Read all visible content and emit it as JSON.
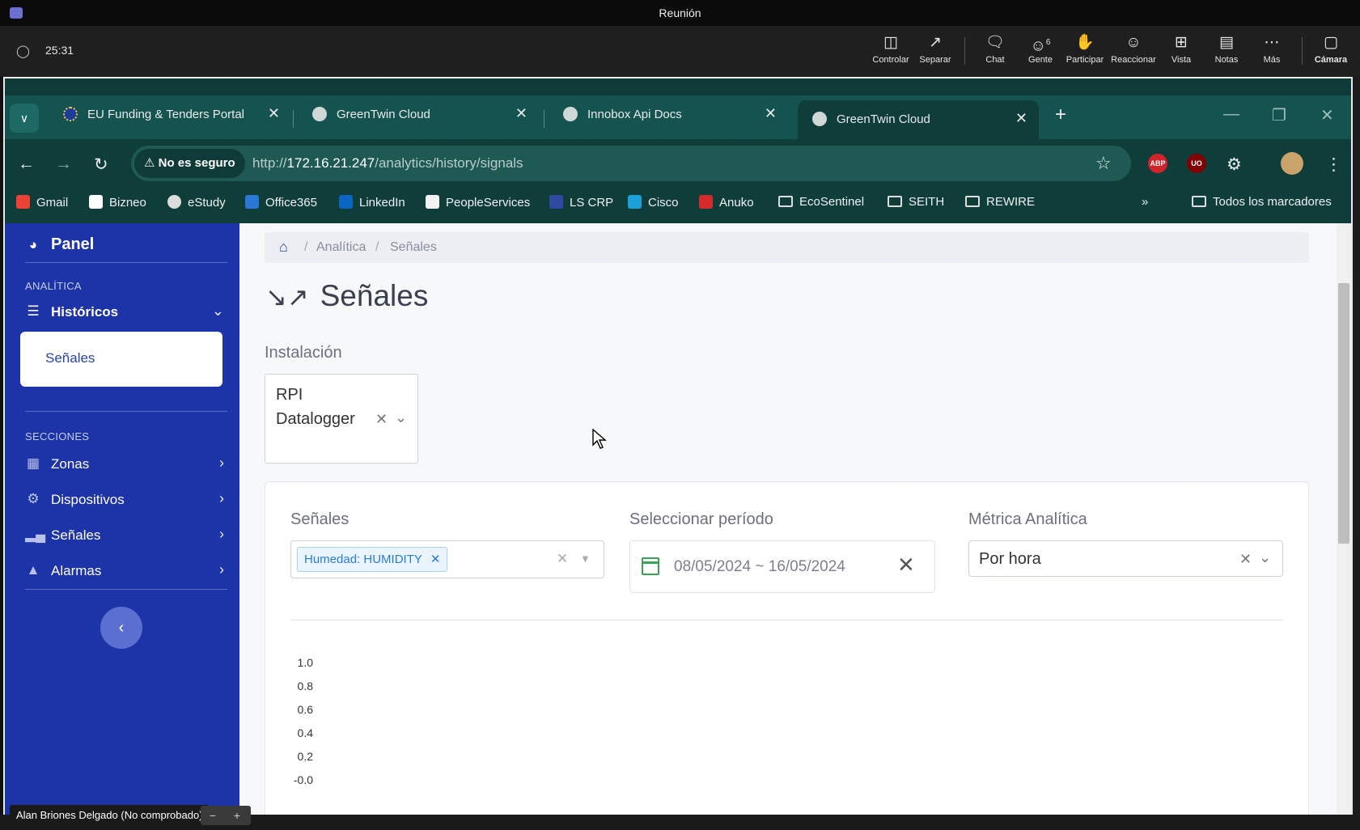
{
  "teams": {
    "title": "Reunión",
    "timer": "25:31",
    "toolbar": [
      {
        "label": "Controlar",
        "icon": "control-icon"
      },
      {
        "label": "Separar",
        "icon": "popout-icon"
      },
      {
        "label": "Chat",
        "icon": "chat-icon"
      },
      {
        "label": "Gente",
        "icon": "people-icon",
        "count": "6"
      },
      {
        "label": "Participar",
        "icon": "raise-hand-icon"
      },
      {
        "label": "Reaccionar",
        "icon": "react-icon"
      },
      {
        "label": "Vista",
        "icon": "view-icon"
      },
      {
        "label": "Notas",
        "icon": "notes-icon"
      },
      {
        "label": "Más",
        "icon": "more-icon"
      },
      {
        "label": "Cámara",
        "icon": "camera-icon"
      }
    ],
    "caption_name": "Alan Briones Delgado (No comprobado)"
  },
  "browser": {
    "tabs": [
      {
        "label": "EU Funding & Tenders Portal"
      },
      {
        "label": "GreenTwin Cloud"
      },
      {
        "label": "Innobox Api Docs"
      },
      {
        "label": "GreenTwin Cloud",
        "active": true
      }
    ],
    "security_chip": "No es seguro",
    "url_prefix": "http://",
    "url_host": "172.16.21.247",
    "url_path": "/analytics/history/signals",
    "extensions": [
      "ABP",
      "UO"
    ],
    "bookmarks": [
      {
        "label": "Gmail",
        "color": "#ea4335"
      },
      {
        "label": "Bizneo",
        "color": "#ffffff"
      },
      {
        "label": "eStudy",
        "color": "#dddddd"
      },
      {
        "label": "Office365",
        "color": "#2a78d6"
      },
      {
        "label": "LinkedIn",
        "color": "#0a66c2"
      },
      {
        "label": "PeopleServices",
        "color": "#f2f2f2"
      },
      {
        "label": "LS CRP",
        "color": "#2f4aa0"
      },
      {
        "label": "Cisco",
        "color": "#1ba0d7"
      },
      {
        "label": "Anuko",
        "color": "#d62b2b"
      },
      {
        "label": "EcoSentinel",
        "folder": true
      },
      {
        "label": "SEITH",
        "folder": true
      },
      {
        "label": "REWIRE",
        "folder": true
      }
    ],
    "all_bookmarks": "Todos los marcadores"
  },
  "sidebar": {
    "brand": "Panel",
    "section_analytics": "ANALÍTICA",
    "historicos": "Históricos",
    "active_item": "Señales",
    "section_sections": "SECCIONES",
    "items": [
      {
        "label": "Zonas",
        "icon": "building-icon"
      },
      {
        "label": "Dispositivos",
        "icon": "devices-icon"
      },
      {
        "label": "Señales",
        "icon": "signal-bars-icon"
      },
      {
        "label": "Alarmas",
        "icon": "warning-icon"
      }
    ]
  },
  "breadcrumb": [
    "Analítica",
    "Señales"
  ],
  "page_title": "Señales",
  "installation": {
    "label": "Instalación",
    "value": "RPI Datalogger"
  },
  "filters": {
    "signals_label": "Señales",
    "signal_chip": "Humedad: HUMIDITY",
    "period_label": "Seleccionar período",
    "period_value": "08/05/2024 ~ 16/05/2024",
    "metric_label": "Métrica Analítica",
    "metric_value": "Por hora"
  },
  "chart_data": {
    "type": "line",
    "title": "",
    "xlabel": "",
    "ylabel": "",
    "ylim": [
      0,
      1.0
    ],
    "yticks": [
      "1.0",
      "0.8",
      "0.6",
      "0.4",
      "0.2",
      "-0.0"
    ],
    "series": []
  }
}
